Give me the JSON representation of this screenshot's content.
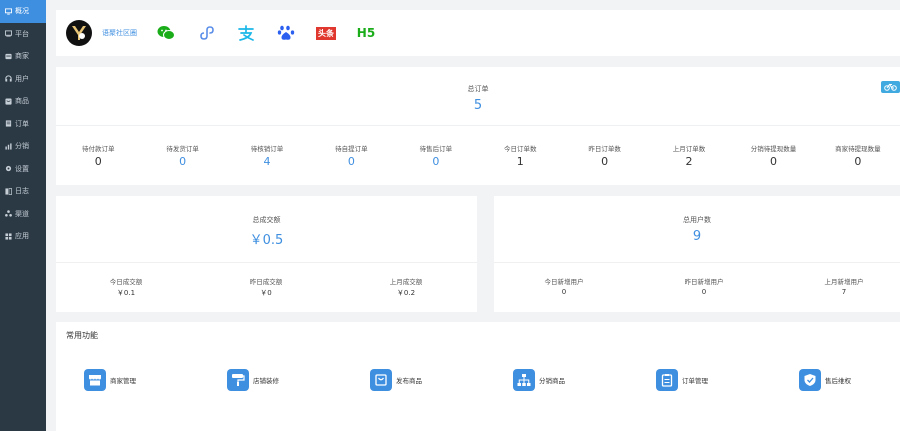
{
  "sidebar": {
    "items": [
      {
        "label": "概况",
        "icon": "monitor-icon",
        "active": true
      },
      {
        "label": "平台",
        "icon": "platform-icon"
      },
      {
        "label": "商家",
        "icon": "merchant-icon"
      },
      {
        "label": "用户",
        "icon": "user-icon"
      },
      {
        "label": "商品",
        "icon": "goods-icon"
      },
      {
        "label": "订单",
        "icon": "order-icon"
      },
      {
        "label": "分销",
        "icon": "distribution-icon"
      },
      {
        "label": "设置",
        "icon": "gear-icon"
      },
      {
        "label": "日志",
        "icon": "log-icon"
      },
      {
        "label": "渠道",
        "icon": "channel-icon"
      },
      {
        "label": "应用",
        "icon": "apps-icon"
      }
    ]
  },
  "appbar": {
    "name": "语聚社区圈",
    "channels": [
      {
        "icon": "wechat-icon"
      },
      {
        "icon": "miniprogram-icon"
      },
      {
        "icon": "alipay-icon"
      },
      {
        "icon": "baidu-icon"
      },
      {
        "icon": "toutiao-icon",
        "text": "头条"
      },
      {
        "icon": "h5-icon",
        "text": "H5"
      }
    ]
  },
  "orders": {
    "total_label": "总订单",
    "total_value": "5",
    "stats": [
      {
        "label": "待付款订单",
        "value": "0",
        "blue": false
      },
      {
        "label": "待发货订单",
        "value": "0",
        "blue": true
      },
      {
        "label": "待核销订单",
        "value": "4",
        "blue": true
      },
      {
        "label": "待自提订单",
        "value": "0",
        "blue": true
      },
      {
        "label": "待售后订单",
        "value": "0",
        "blue": true
      },
      {
        "label": "今日订单数",
        "value": "1",
        "blue": false
      },
      {
        "label": "昨日订单数",
        "value": "0",
        "blue": false
      },
      {
        "label": "上月订单数",
        "value": "2",
        "blue": false
      },
      {
        "label": "分销待提现数量",
        "value": "0",
        "blue": false
      },
      {
        "label": "商家待提现数量",
        "value": "0",
        "blue": false
      }
    ]
  },
  "deals": {
    "total_label": "总成交额",
    "total_value": "￥0.5",
    "stats": [
      {
        "label": "今日成交额",
        "value": "￥0.1"
      },
      {
        "label": "昨日成交额",
        "value": "￥0"
      },
      {
        "label": "上月成交额",
        "value": "￥0.2"
      }
    ]
  },
  "users": {
    "total_label": "总用户数",
    "total_value": "9",
    "stats": [
      {
        "label": "今日新增用户",
        "value": "0"
      },
      {
        "label": "昨日新增用户",
        "value": "0"
      },
      {
        "label": "上月新增用户",
        "value": "7"
      }
    ]
  },
  "functions": {
    "title": "常用功能",
    "items": [
      {
        "label": "商家管理",
        "icon": "store-icon"
      },
      {
        "label": "店铺装修",
        "icon": "paint-roller-icon"
      },
      {
        "label": "发布商品",
        "icon": "shopping-bag-icon"
      },
      {
        "label": "分销商品",
        "icon": "sitemap-icon"
      },
      {
        "label": "订单管理",
        "icon": "clipboard-icon"
      },
      {
        "label": "售后维权",
        "icon": "shield-icon"
      }
    ]
  },
  "colors": {
    "accent": "#3f8fe0",
    "sidebar": "#2b3945"
  }
}
